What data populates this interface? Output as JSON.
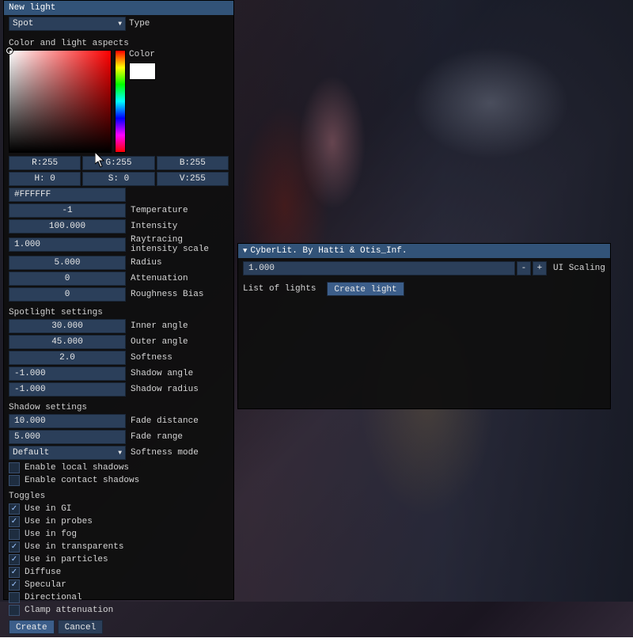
{
  "left": {
    "title": "New light",
    "type": {
      "value": "Spot",
      "label": "Type"
    },
    "color_section": "Color and light aspects",
    "swatch_label": "Color",
    "rgb": {
      "r": "R:255",
      "g": "G:255",
      "b": "B:255"
    },
    "hsv": {
      "h": "H: 0",
      "s": "S: 0",
      "v": "V:255"
    },
    "hex": "#FFFFFF",
    "fields": {
      "temperature": {
        "value": "-1",
        "label": "Temperature"
      },
      "intensity": {
        "value": "100.000",
        "label": "Intensity"
      },
      "rtscale": {
        "value": "1.000",
        "label": "Raytracing intensity scale"
      },
      "radius": {
        "value": "5.000",
        "label": "Radius"
      },
      "attenuation": {
        "value": "0",
        "label": "Attenuation"
      },
      "roughness": {
        "value": "0",
        "label": "Roughness Bias"
      }
    },
    "spot_section": "Spotlight settings",
    "spot": {
      "inner": {
        "value": "30.000",
        "label": "Inner angle"
      },
      "outer": {
        "value": "45.000",
        "label": "Outer angle"
      },
      "softness": {
        "value": "2.0",
        "label": "Softness"
      },
      "shadow_angle": {
        "value": "-1.000",
        "label": "Shadow angle"
      },
      "shadow_radius": {
        "value": "-1.000",
        "label": "Shadow radius"
      }
    },
    "shadow_section": "Shadow settings",
    "shadow": {
      "fade_dist": {
        "value": "10.000",
        "label": "Fade distance"
      },
      "fade_range": {
        "value": "5.000",
        "label": "Fade range"
      },
      "softness_mode": {
        "value": "Default",
        "label": "Softness mode"
      },
      "local": "Enable local shadows",
      "contact": "Enable contact shadows"
    },
    "toggles_section": "Toggles",
    "toggles": {
      "gi": "Use in GI",
      "probes": "Use in probes",
      "fog": "Use in fog",
      "transparents": "Use in transparents",
      "particles": "Use in particles",
      "diffuse": "Diffuse",
      "specular": "Specular",
      "directional": "Directional",
      "clamp": "Clamp attenuation"
    },
    "buttons": {
      "create": "Create",
      "cancel": "Cancel"
    }
  },
  "right": {
    "title": "CyberLit. By Hatti & Otis_Inf.",
    "scaling": {
      "value": "1.000",
      "minus": "-",
      "plus": "+",
      "label": "UI Scaling"
    },
    "list_label": "List of lights",
    "create_label": "Create light"
  }
}
